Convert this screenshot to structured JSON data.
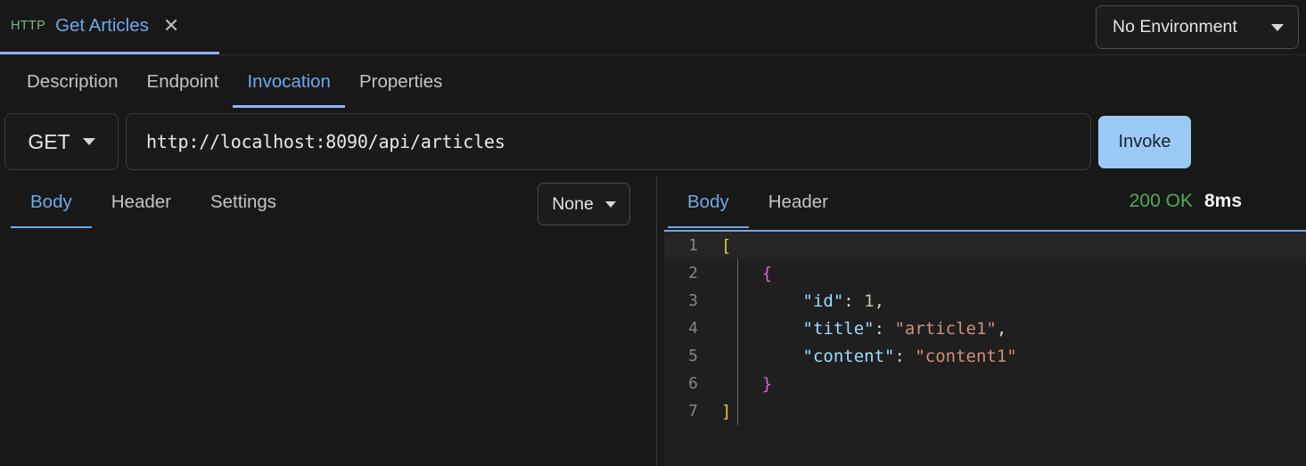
{
  "window": {
    "tab": {
      "protocol": "HTTP",
      "title": "Get Articles",
      "close_icon": "close-icon",
      "close_glyph": "✕"
    },
    "environment": {
      "label": "No Environment",
      "caret_icon": "chevron-down-icon"
    }
  },
  "main_tabs": [
    {
      "label": "Description",
      "active": false
    },
    {
      "label": "Endpoint",
      "active": false
    },
    {
      "label": "Invocation",
      "active": true
    },
    {
      "label": "Properties",
      "active": false
    }
  ],
  "request": {
    "method": "GET",
    "method_caret_icon": "chevron-down-icon",
    "url": "http://localhost:8090/api/articles",
    "url_placeholder": "Enter URL",
    "invoke_label": "Invoke"
  },
  "request_panel": {
    "tabs": [
      {
        "label": "Body",
        "active": true
      },
      {
        "label": "Header",
        "active": false
      },
      {
        "label": "Settings",
        "active": false
      }
    ],
    "body_type": "None",
    "body_caret_icon": "chevron-down-icon",
    "body_content": ""
  },
  "response_panel": {
    "tabs": [
      {
        "label": "Body",
        "active": true
      },
      {
        "label": "Header",
        "active": false
      }
    ],
    "status_code": "200 OK",
    "duration": "8ms",
    "lines": [
      {
        "n": "1",
        "current": true,
        "tokens": [
          {
            "t": "[",
            "c": "tk-brk"
          }
        ]
      },
      {
        "n": "2",
        "current": false,
        "tokens": [
          {
            "t": "    ",
            "c": "tk-pun"
          },
          {
            "t": "{",
            "c": "tk-brc"
          }
        ]
      },
      {
        "n": "3",
        "current": false,
        "tokens": [
          {
            "t": "        ",
            "c": "tk-pun"
          },
          {
            "t": "\"id\"",
            "c": "tk-key"
          },
          {
            "t": ": ",
            "c": "tk-pun"
          },
          {
            "t": "1",
            "c": "tk-num"
          },
          {
            "t": ",",
            "c": "tk-pun"
          }
        ]
      },
      {
        "n": "4",
        "current": false,
        "tokens": [
          {
            "t": "        ",
            "c": "tk-pun"
          },
          {
            "t": "\"title\"",
            "c": "tk-key"
          },
          {
            "t": ": ",
            "c": "tk-pun"
          },
          {
            "t": "\"article1\"",
            "c": "tk-str"
          },
          {
            "t": ",",
            "c": "tk-pun"
          }
        ]
      },
      {
        "n": "5",
        "current": false,
        "tokens": [
          {
            "t": "        ",
            "c": "tk-pun"
          },
          {
            "t": "\"content\"",
            "c": "tk-key"
          },
          {
            "t": ": ",
            "c": "tk-pun"
          },
          {
            "t": "\"content1\"",
            "c": "tk-str"
          }
        ]
      },
      {
        "n": "6",
        "current": false,
        "tokens": [
          {
            "t": "    ",
            "c": "tk-pun"
          },
          {
            "t": "}",
            "c": "tk-brc"
          }
        ]
      },
      {
        "n": "7",
        "current": false,
        "tokens": [
          {
            "t": "]",
            "c": "tk-brk"
          }
        ]
      }
    ]
  },
  "colors": {
    "accent_blue": "#6ea8e8",
    "tab_underline": "#8ab4f8",
    "protocol_green": "#73bb72",
    "status_green": "#4fad52",
    "invoke_bg": "#9ccaf7",
    "editor_bg": "#1f1f1f",
    "panel_bg": "#181818",
    "json_bracket": "#e8c44a",
    "json_brace": "#d862d8",
    "json_key": "#9cdcfe",
    "json_string": "#ce9178",
    "json_number": "#b5cea8"
  }
}
